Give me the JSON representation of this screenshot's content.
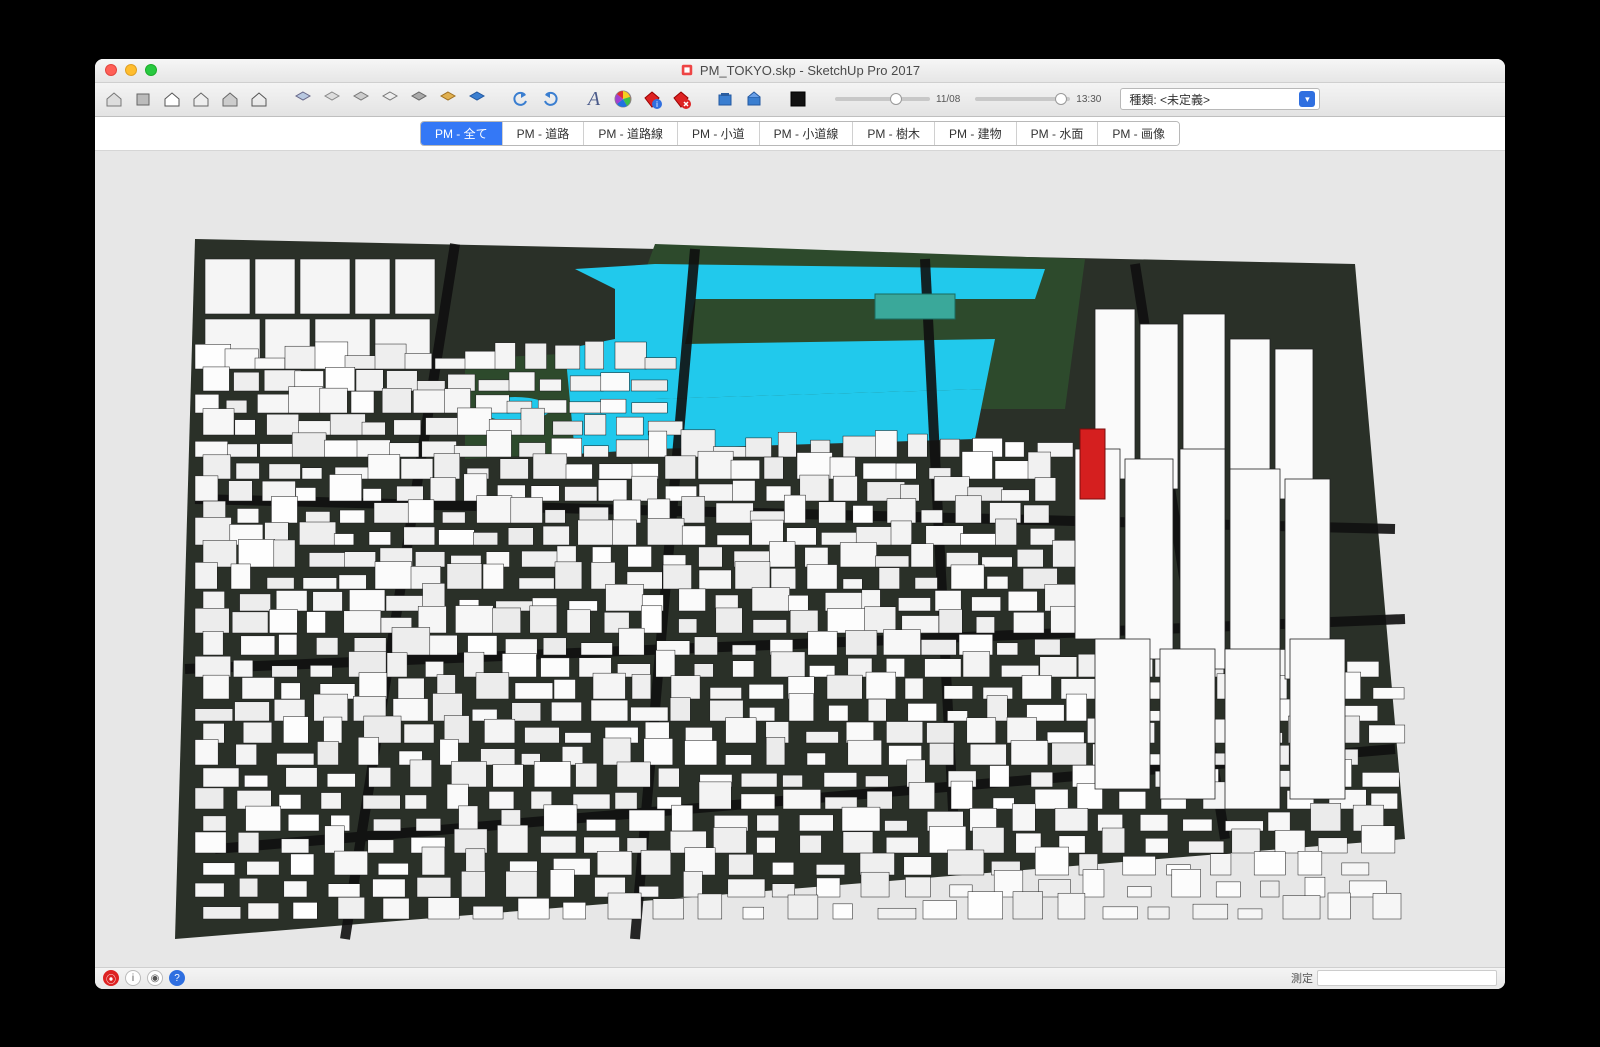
{
  "window": {
    "title": "PM_TOKYO.skp - SketchUp Pro 2017"
  },
  "toolbar": {
    "icons": [
      "scene-1",
      "scene-2",
      "scene-3",
      "scene-4",
      "scene-5",
      "scene-6",
      "layer-1",
      "layer-2",
      "layer-3",
      "layer-4",
      "layer-5",
      "layer-6",
      "layer-7",
      "undo",
      "redo",
      "text-A",
      "color-wheel",
      "ruby-info",
      "ruby-red",
      "box-blue",
      "box-open",
      "swatch-black"
    ],
    "slider1_label": "11/08",
    "slider2_label": "13:30",
    "kind_label_prefix": "種類:",
    "kind_value": " <未定義>"
  },
  "tabs": [
    {
      "label": "PM - 全て",
      "active": true
    },
    {
      "label": "PM - 道路",
      "active": false
    },
    {
      "label": "PM - 道路線",
      "active": false
    },
    {
      "label": "PM - 小道",
      "active": false
    },
    {
      "label": "PM - 小道線",
      "active": false
    },
    {
      "label": "PM - 樹木",
      "active": false
    },
    {
      "label": "PM - 建物",
      "active": false
    },
    {
      "label": "PM - 水面",
      "active": false
    },
    {
      "label": "PM - 画像",
      "active": false
    }
  ],
  "status": {
    "measure_label": "測定",
    "measure_value": ""
  }
}
